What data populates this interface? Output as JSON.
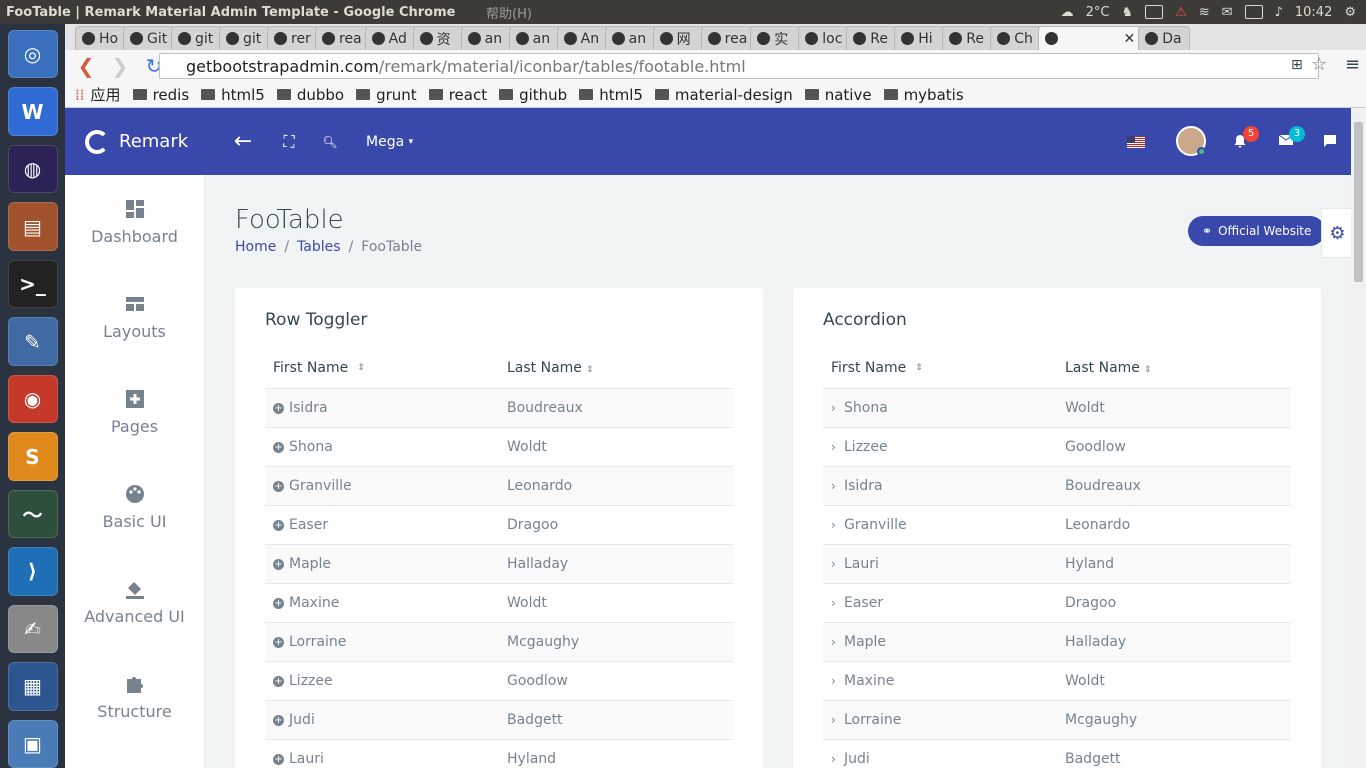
{
  "os": {
    "window_title": "FooTable | Remark Material Admin Template - Google Chrome",
    "menu_extra": "帮助(H)",
    "weather": "2°C",
    "clock": "10:42"
  },
  "launcher": {
    "apps": [
      {
        "name": "ubuntu-icon",
        "glyph": "◎",
        "color": "#3a6fbd"
      },
      {
        "name": "wps-writer-icon",
        "glyph": "W",
        "color": "#2f6bd3"
      },
      {
        "name": "eclipse-icon",
        "glyph": "◍",
        "color": "#2c2255"
      },
      {
        "name": "file-manager-icon",
        "glyph": "▤",
        "color": "#a0522d"
      },
      {
        "name": "terminal-icon",
        "glyph": ">_",
        "color": "#222"
      },
      {
        "name": "screen-tool-icon",
        "glyph": "✎",
        "color": "#3f6aa3"
      },
      {
        "name": "chrome-icon",
        "glyph": "◉",
        "color": "#c5392b"
      },
      {
        "name": "sublime-icon",
        "glyph": "S",
        "color": "#e08a1e"
      },
      {
        "name": "system-monitor-icon",
        "glyph": "〜",
        "color": "#2e4f3c"
      },
      {
        "name": "vscode-icon",
        "glyph": "⟩",
        "color": "#1f6fb7"
      },
      {
        "name": "text-editor-icon",
        "glyph": "✍",
        "color": "#888"
      },
      {
        "name": "workspace-icon",
        "glyph": "▦",
        "color": "#2d5690"
      },
      {
        "name": "image-viewer-icon",
        "glyph": "▣",
        "color": "#4a7bb7"
      }
    ]
  },
  "browser": {
    "tabs": [
      {
        "label": "Ho"
      },
      {
        "label": "Git"
      },
      {
        "label": "git"
      },
      {
        "label": "git"
      },
      {
        "label": "rer"
      },
      {
        "label": "rea"
      },
      {
        "label": "Ad"
      },
      {
        "label": "资"
      },
      {
        "label": "an"
      },
      {
        "label": "an"
      },
      {
        "label": "An"
      },
      {
        "label": "an"
      },
      {
        "label": "网"
      },
      {
        "label": "rea"
      },
      {
        "label": "实"
      },
      {
        "label": "loc"
      },
      {
        "label": "Re"
      },
      {
        "label": "Hi"
      },
      {
        "label": "Re"
      },
      {
        "label": "Ch"
      },
      {
        "label": ""
      },
      {
        "label": "Da"
      }
    ],
    "url_host": "getbootstrapadmin.com",
    "url_path": "/remark/material/iconbar/tables/footable.html",
    "bookmarks": [
      {
        "label": "应用"
      },
      {
        "label": "redis"
      },
      {
        "label": "html5"
      },
      {
        "label": "dubbo"
      },
      {
        "label": "grunt"
      },
      {
        "label": "react"
      },
      {
        "label": "github"
      },
      {
        "label": "html5"
      },
      {
        "label": "material-design"
      },
      {
        "label": "native"
      },
      {
        "label": "mybatis"
      }
    ]
  },
  "header": {
    "brand": "Remark",
    "mega_label": "Mega",
    "notifications_count": "5",
    "messages_count": "3",
    "brand_color": "#3949ab"
  },
  "sidebar": {
    "items": [
      {
        "label": "Dashboard"
      },
      {
        "label": "Layouts"
      },
      {
        "label": "Pages"
      },
      {
        "label": "Basic UI"
      },
      {
        "label": "Advanced UI"
      },
      {
        "label": "Structure"
      }
    ]
  },
  "page": {
    "title": "FooTable",
    "breadcrumb": {
      "home": "Home",
      "section": "Tables",
      "current": "FooTable",
      "sep": "/"
    },
    "official_button": "Official Website"
  },
  "panels": {
    "row_toggler": {
      "title": "Row Toggler",
      "columns": [
        "First Name",
        "Last Name"
      ],
      "rows": [
        [
          "Isidra",
          "Boudreaux"
        ],
        [
          "Shona",
          "Woldt"
        ],
        [
          "Granville",
          "Leonardo"
        ],
        [
          "Easer",
          "Dragoo"
        ],
        [
          "Maple",
          "Halladay"
        ],
        [
          "Maxine",
          "Woldt"
        ],
        [
          "Lorraine",
          "Mcgaughy"
        ],
        [
          "Lizzee",
          "Goodlow"
        ],
        [
          "Judi",
          "Badgett"
        ],
        [
          "Lauri",
          "Hyland"
        ]
      ]
    },
    "accordion": {
      "title": "Accordion",
      "columns": [
        "First Name",
        "Last Name"
      ],
      "rows": [
        [
          "Shona",
          "Woldt"
        ],
        [
          "Lizzee",
          "Goodlow"
        ],
        [
          "Isidra",
          "Boudreaux"
        ],
        [
          "Granville",
          "Leonardo"
        ],
        [
          "Lauri",
          "Hyland"
        ],
        [
          "Easer",
          "Dragoo"
        ],
        [
          "Maple",
          "Halladay"
        ],
        [
          "Maxine",
          "Woldt"
        ],
        [
          "Lorraine",
          "Mcgaughy"
        ],
        [
          "Judi",
          "Badgett"
        ]
      ]
    }
  }
}
